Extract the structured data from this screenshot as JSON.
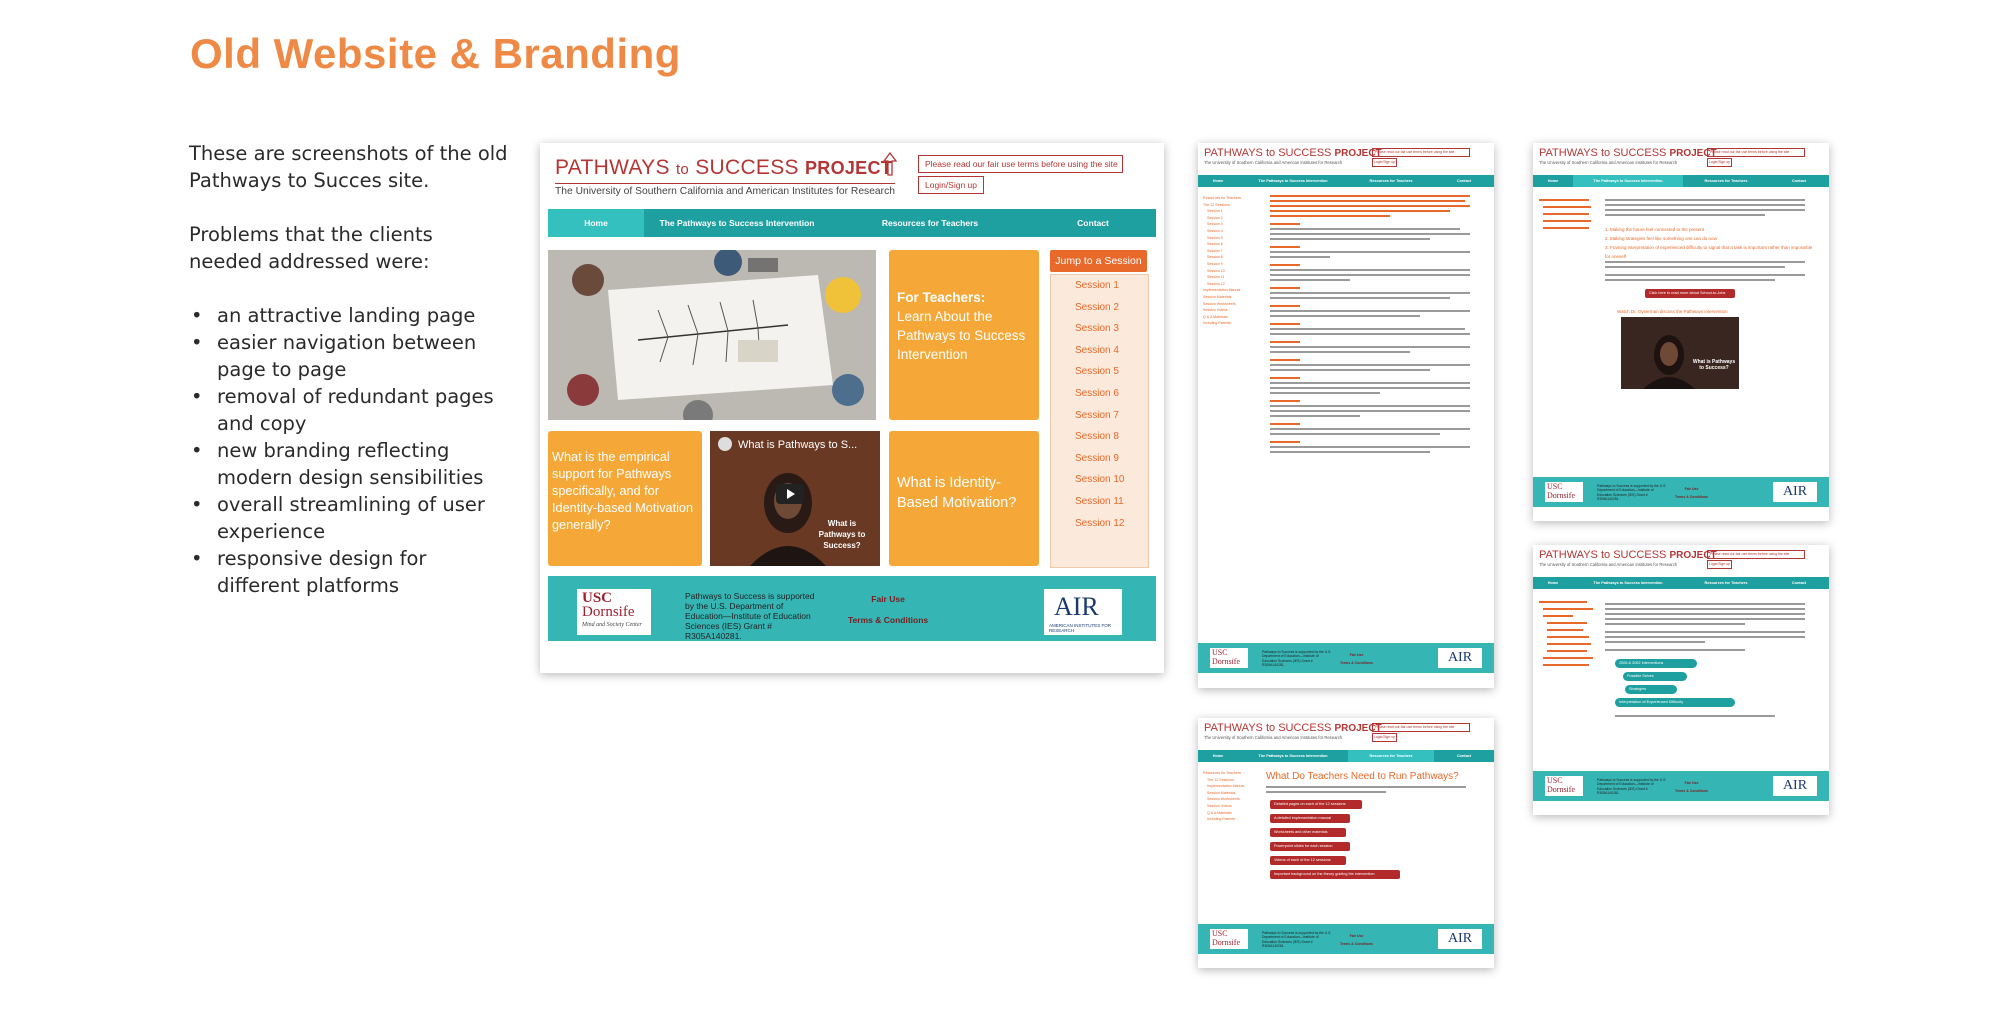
{
  "page": {
    "title": "Old Website & Branding",
    "intro": "These are screenshots of the old Pathways to Succes site.",
    "problems_intro": "Problems that the clients needed addressed were:",
    "problems": [
      "an attractive landing page",
      "easier navigation between page to page",
      "removal of redundant pages and copy",
      "new branding reflecting modern design sensibilities",
      "overall streamlining of  user experience",
      "responsive design for different platforms"
    ]
  },
  "site": {
    "logo_pathways": "PATHWAYS",
    "logo_to": "to",
    "logo_success": "SUCCESS",
    "logo_project": "PROJECT",
    "logo_subtitle": "The University of Southern California and American Institutes for Research",
    "terms_notice": "Please read our fair use terms before using the site",
    "login": "Login/Sign up",
    "nav": [
      "Home",
      "The Pathways to Success Intervention",
      "Resources for Teachers",
      "Contact"
    ],
    "teachers_tile_heading": "For Teachers:",
    "teachers_tile_body": "Learn About the Pathways to Success Intervention",
    "empirical_tile": "What is the empirical support for Pathways specifically, and for Identity-based Motivation generally?",
    "video_title": "What is Pathways to S...",
    "video_caption": "What is Pathways to Success?",
    "identity_tile": "What is Identity-Based Motivation?",
    "jump_button": "Jump to a Session",
    "sessions": [
      "Session 1",
      "Session 2",
      "Session 3",
      "Session 4",
      "Session 5",
      "Session 6",
      "Session 7",
      "Session 8",
      "Session 9",
      "Session 10",
      "Session 11",
      "Session 12"
    ],
    "usc_line1": "USC",
    "usc_line2": "Dornsife",
    "usc_line3": "Mind and Society Center",
    "funding": "Pathways to Success is supported by the U.S. Department of Education—Institute of Education Sciences (IES) Grant # R305A140281.",
    "fair_use": "Fair Use",
    "terms": "Terms & Conditions",
    "air_logo": "AIR",
    "air_sub": "AMERICAN INSTITUTES FOR RESEARCH"
  },
  "mini_sessions": {
    "side": [
      "Resources for Teachers",
      "The 12 Sessions",
      "Session 1",
      "Session 2",
      "Session 3",
      "Session 4",
      "Session 5",
      "Session 6",
      "Session 7",
      "Session 8",
      "Session 9",
      "Session 10",
      "Session 11",
      "Session 12",
      "Implementation Manual",
      "Session Materials",
      "Session Worksheets",
      "Session Videos",
      "Q & A Materials",
      "Including Parents"
    ]
  },
  "mini_teachers": {
    "heading": "What Do Teachers Need to Run Pathways?",
    "items": [
      "Detailed pages on each of the 12 sessions",
      "A detailed implementation manual",
      "Worksheets and other materials",
      "Powerpoint slides for each session",
      "Videos of each of the 12 sessions",
      "Important background on the theory guiding the intervention"
    ]
  },
  "mini_intervention": {
    "list": [
      "1. Making the future feel connected to the present",
      "2. Making strategies feel like something one can do now",
      "3. Framing interpretation of experienced difficulty to signal that a task is important rather than impossible for oneself"
    ],
    "cta": "Click here to read more about School-to-Jobs",
    "video_link": "Watch Dr. Oyserman discuss the Pathways intervention",
    "video_caption": "What is Pathways to Success?"
  },
  "mini_research": {
    "buttons": [
      "2006 & 2002 Interventions",
      "Possible Selves",
      "Strategies",
      "Interpretation of Experienced Difficulty"
    ]
  },
  "colors": {
    "accent_orange": "#ee8a45",
    "teal": "#1e9fa0",
    "tile_orange": "#f5a838",
    "session_orange": "#e8692a",
    "brand_red": "#b43634"
  }
}
